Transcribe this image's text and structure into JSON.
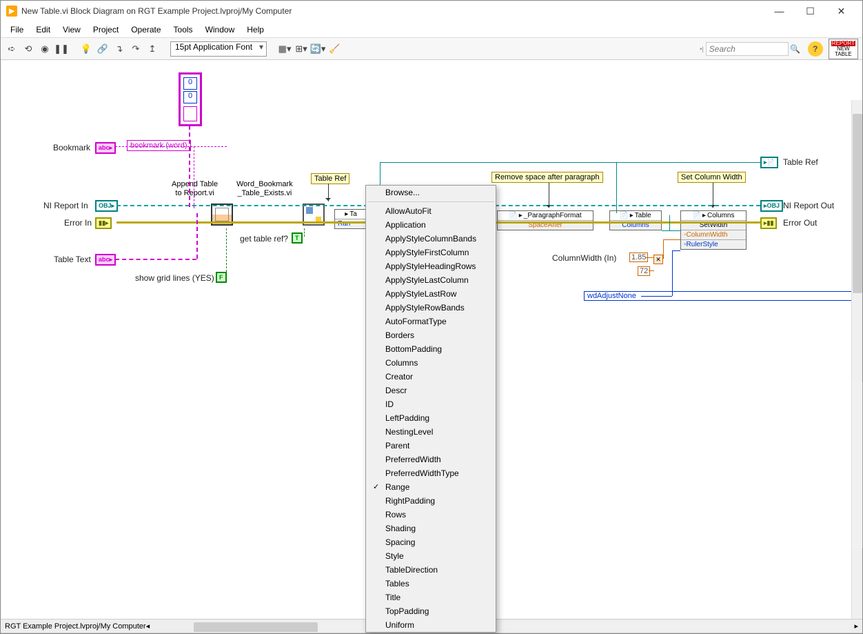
{
  "window": {
    "title": "New Table.vi Block Diagram on RGT Example Project.lvproj/My Computer",
    "minimize": "—",
    "maximize": "☐",
    "close": "✕"
  },
  "menu": [
    "File",
    "Edit",
    "View",
    "Project",
    "Operate",
    "Tools",
    "Window",
    "Help"
  ],
  "toolbar": {
    "font": "15pt Application Font",
    "search_placeholder": "Search",
    "badge_line1": "REPORT",
    "badge_line2": "NEW",
    "badge_line3": "TABLE"
  },
  "diagram": {
    "labels": {
      "bookmark": "Bookmark",
      "bookmark_word": "bookmark (word)",
      "ni_report_in": "NI Report In",
      "error_in": "Error In",
      "table_text": "Table Text",
      "show_grid": "show grid lines (YES)",
      "get_table_ref": "get table ref?",
      "append_table": "Append Table\nto Report.vi",
      "bookmark_exists": "Word_Bookmark\n_Table_Exists.vi",
      "table_ref_comment": "Table Ref",
      "remove_space": "Remove space after paragraph",
      "set_col_width": "Set Column Width",
      "paragraph_fmt": "_ParagraphFormat",
      "space_after": "SpaceAfter",
      "table_node": "Table",
      "columns_prop": "Columns",
      "columns_node": "Columns",
      "setwidth": "SetWidth",
      "col_width": "ColumnWidth",
      "ruler_style": "RulerStyle",
      "col_width_in": "ColumnWidth (In)",
      "wd_adjust": "wdAdjustNone",
      "table_ref_out": "Table Ref",
      "ni_report_out": "NI Report Out",
      "error_out": "Error Out",
      "arr_0a": "0",
      "arr_0b": "0",
      "num_185": "1.85",
      "num_72": "72",
      "truncated_node": "Ta",
      "truncated_prop": "Ran"
    }
  },
  "context_menu": {
    "browse": "Browse...",
    "items": [
      "AllowAutoFit",
      "Application",
      "ApplyStyleColumnBands",
      "ApplyStyleFirstColumn",
      "ApplyStyleHeadingRows",
      "ApplyStyleLastColumn",
      "ApplyStyleLastRow",
      "ApplyStyleRowBands",
      "AutoFormatType",
      "Borders",
      "BottomPadding",
      "Columns",
      "Creator",
      "Descr",
      "ID",
      "LeftPadding",
      "NestingLevel",
      "Parent",
      "PreferredWidth",
      "PreferredWidthType",
      "Range",
      "RightPadding",
      "Rows",
      "Shading",
      "Spacing",
      "Style",
      "TableDirection",
      "Tables",
      "Title",
      "TopPadding",
      "Uniform"
    ],
    "checked": "Range"
  },
  "statusbar": {
    "path": "RGT Example Project.lvproj/My Computer"
  }
}
